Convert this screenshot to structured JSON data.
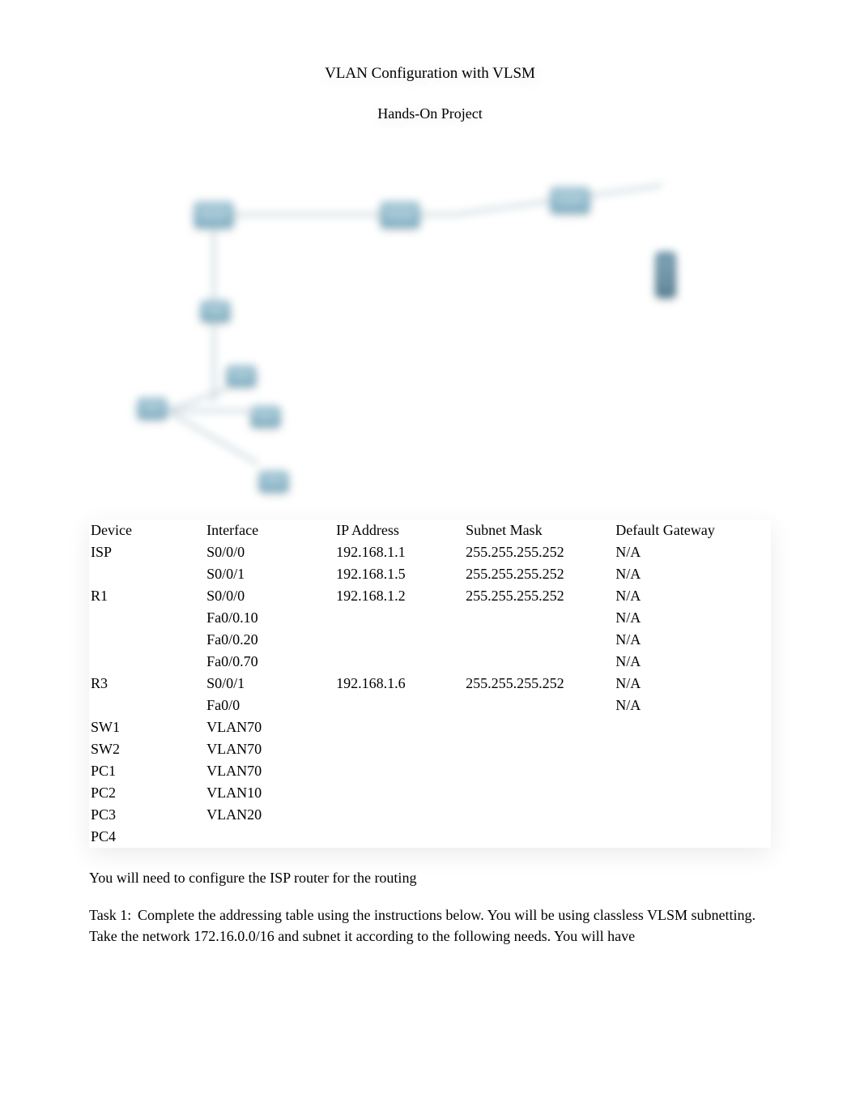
{
  "title": "VLAN Configuration with VLSM",
  "subtitle": "Hands-On Project",
  "table": {
    "headers": {
      "device": "Device",
      "interface": "Interface",
      "ip": "IP Address",
      "mask": "Subnet Mask",
      "gateway": "Default Gateway"
    },
    "rows": [
      {
        "device": "ISP",
        "interface": "S0/0/0",
        "ip": "192.168.1.1",
        "mask": "255.255.255.252",
        "gateway": "N/A"
      },
      {
        "device": "",
        "interface": "S0/0/1",
        "ip": "192.168.1.5",
        "mask": "255.255.255.252",
        "gateway": "N/A"
      },
      {
        "device": "R1",
        "interface": "S0/0/0",
        "ip": "192.168.1.2",
        "mask": "255.255.255.252",
        "gateway": "N/A"
      },
      {
        "device": "",
        "interface": "Fa0/0.10",
        "ip": "",
        "mask": "",
        "gateway": "N/A"
      },
      {
        "device": "",
        "interface": "Fa0/0.20",
        "ip": "",
        "mask": "",
        "gateway": "N/A"
      },
      {
        "device": "",
        "interface": "Fa0/0.70",
        "ip": "",
        "mask": "",
        "gateway": "N/A"
      },
      {
        "device": "R3",
        "interface": "S0/0/1",
        "ip": "192.168.1.6",
        "mask": "255.255.255.252",
        "gateway": "N/A"
      },
      {
        "device": "",
        "interface": "Fa0/0",
        "ip": "",
        "mask": "",
        "gateway": "N/A"
      },
      {
        "device": "SW1",
        "interface": "VLAN70",
        "ip": "",
        "mask": "",
        "gateway": ""
      },
      {
        "device": "SW2",
        "interface": "VLAN70",
        "ip": "",
        "mask": "",
        "gateway": ""
      },
      {
        "device": "PC1",
        "interface": "VLAN70",
        "ip": "",
        "mask": "",
        "gateway": ""
      },
      {
        "device": "PC2",
        "interface": "VLAN10",
        "ip": "",
        "mask": "",
        "gateway": ""
      },
      {
        "device": "PC3",
        "interface": "VLAN20",
        "ip": "",
        "mask": "",
        "gateway": ""
      },
      {
        "device": "PC4",
        "interface": "",
        "ip": "",
        "mask": "",
        "gateway": ""
      }
    ]
  },
  "body": {
    "line1": "You will need to configure the ISP router for the routing",
    "task1_label": "Task 1:",
    "task1_text": "Complete the addressing table using the instructions below. You will be using classless VLSM subnetting. Take the network 172.16.0.0/16 and subnet it according to the following needs. You will have"
  }
}
